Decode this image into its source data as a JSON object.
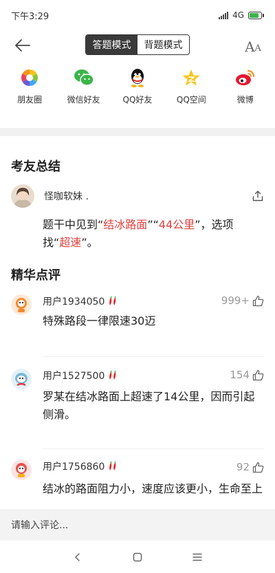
{
  "status": {
    "time": "下午3:29",
    "network": "4G"
  },
  "modes": {
    "active": "答题模式",
    "inactive": "背题模式"
  },
  "share": [
    {
      "label": "朋友圈",
      "icon": "moments-icon"
    },
    {
      "label": "微信好友",
      "icon": "wechat-icon"
    },
    {
      "label": "QQ好友",
      "icon": "qq-icon"
    },
    {
      "label": "QQ空间",
      "icon": "qzone-icon"
    },
    {
      "label": "微博",
      "icon": "weibo-icon"
    }
  ],
  "summary": {
    "title": "考友总结",
    "user": "怪咖软妹 .",
    "text_parts": [
      "题干中见到“",
      "结冰路面",
      "”“",
      "44公里",
      "”，选项找“",
      "超速",
      "”。"
    ]
  },
  "featured": {
    "title": "精华点评",
    "comments": [
      {
        "user": "用户1934050",
        "likes": "999+",
        "text": "特殊路段一律限速30迈"
      },
      {
        "user": "用户1527500",
        "likes": "154",
        "text": "罗某在结冰路面上超速了14公里，因而引起侧滑。"
      },
      {
        "user": "用户1756860",
        "likes": "92",
        "text": "结冰的路面阻力小，速度应该更小，生命至上"
      }
    ]
  },
  "comment_input": {
    "placeholder": "请输入评论..."
  },
  "colors": {
    "highlight": "#e0403c",
    "accent_dark": "#3a3a3a"
  }
}
